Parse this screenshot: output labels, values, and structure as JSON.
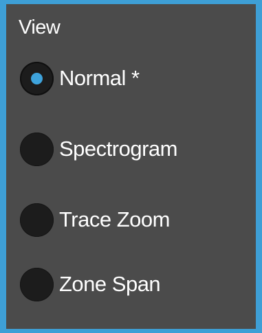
{
  "panel": {
    "title": "View",
    "options": [
      {
        "label": "Normal *",
        "checked": true
      },
      {
        "label": "Spectrogram",
        "checked": false
      },
      {
        "label": "Trace Zoom",
        "checked": false
      },
      {
        "label": "Zone Span",
        "checked": false
      }
    ]
  },
  "colors": {
    "border": "#3e9fd6",
    "background": "#4b4b4b",
    "radio_fill": "#1c1c1c",
    "radio_dot": "#3ea3dc",
    "text": "#ffffff"
  }
}
